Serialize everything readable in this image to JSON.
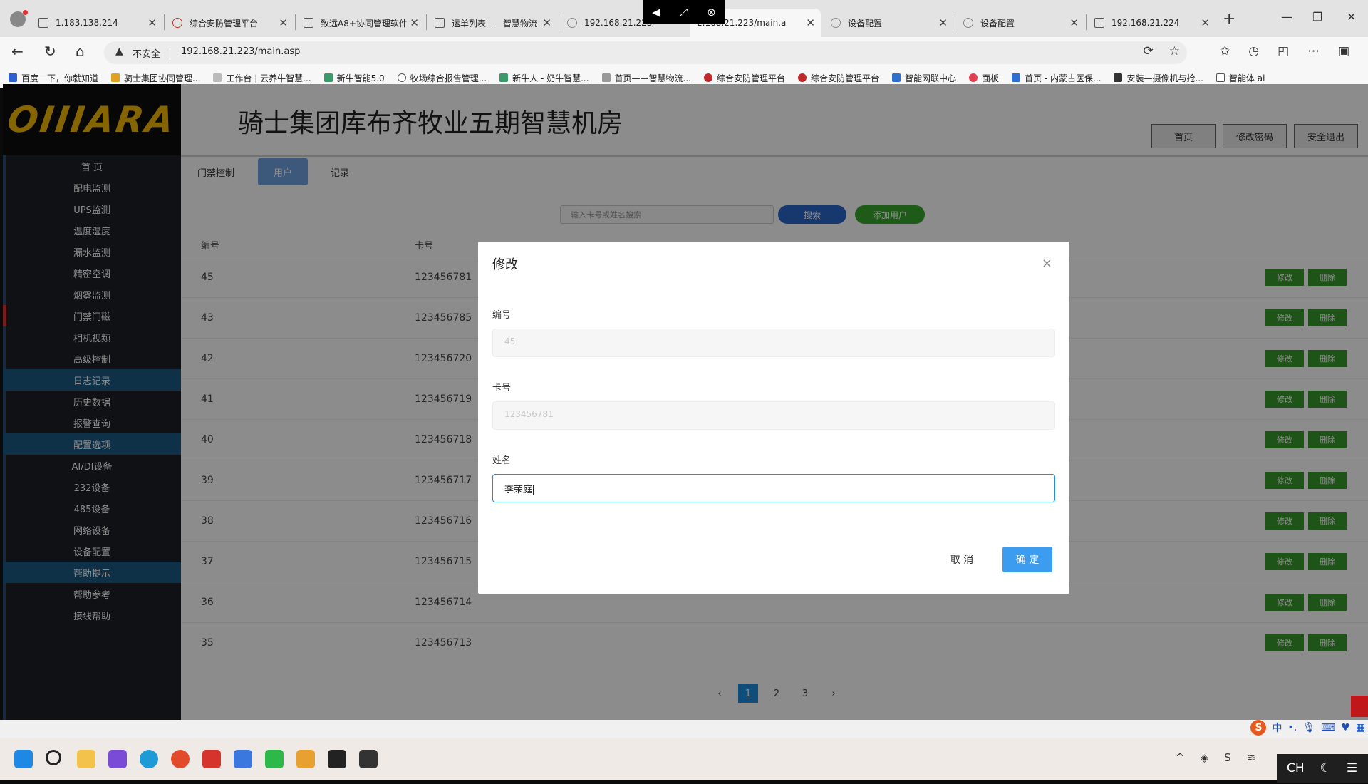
{
  "browser": {
    "tabs": [
      {
        "title": "1.183.138.214"
      },
      {
        "title": "综合安防管理平台"
      },
      {
        "title": "致远A8+协同管理软件"
      },
      {
        "title": "运单列表——智慧物流"
      },
      {
        "title": "192.168.21.223/"
      },
      {
        "title": "2.168.21.223/main.a"
      },
      {
        "title": "设备配置"
      },
      {
        "title": "设备配置"
      },
      {
        "title": "192.168.21.224"
      }
    ],
    "security_label": "不安全",
    "url": "192.168.21.223/main.asp",
    "bookmarks": [
      "百度一下，你就知道",
      "骑士集团协同管理...",
      "工作台 | 云养牛智慧...",
      "新牛智能5.0",
      "牧场综合报告管理...",
      "新牛人 - 奶牛智慧...",
      "首页——智慧物流...",
      "综合安防管理平台",
      "综合安防管理平台",
      "智能网联中心",
      "面板",
      "首页 - 内蒙古医保...",
      "安装—摄像机与抢...",
      "智能体 ai"
    ]
  },
  "header": {
    "logo_text": "OIIIARA",
    "title": "骑士集团库布齐牧业五期智慧机房",
    "buttons": [
      "首页",
      "修改密码",
      "安全退出"
    ]
  },
  "sidebar": {
    "items": [
      {
        "label": "首 页",
        "type": "item"
      },
      {
        "label": "配电监测",
        "type": "item"
      },
      {
        "label": "UPS监测",
        "type": "item"
      },
      {
        "label": "温度湿度",
        "type": "item"
      },
      {
        "label": "漏水监测",
        "type": "item"
      },
      {
        "label": "精密空调",
        "type": "item"
      },
      {
        "label": "烟雾监测",
        "type": "item"
      },
      {
        "label": "门禁门磁",
        "type": "active"
      },
      {
        "label": "相机视频",
        "type": "item"
      },
      {
        "label": "高级控制",
        "type": "item"
      },
      {
        "label": "日志记录",
        "type": "section"
      },
      {
        "label": "历史数据",
        "type": "item"
      },
      {
        "label": "报警查询",
        "type": "item"
      },
      {
        "label": "配置选项",
        "type": "section"
      },
      {
        "label": "AI/DI设备",
        "type": "item"
      },
      {
        "label": "232设备",
        "type": "item"
      },
      {
        "label": "485设备",
        "type": "item"
      },
      {
        "label": "网络设备",
        "type": "item"
      },
      {
        "label": "设备配置",
        "type": "item"
      },
      {
        "label": "帮助提示",
        "type": "section"
      },
      {
        "label": "帮助参考",
        "type": "item"
      },
      {
        "label": "接线帮助",
        "type": "item"
      }
    ]
  },
  "content": {
    "tabs": [
      "门禁控制",
      "用户",
      "记录"
    ],
    "selected_tab": "用户",
    "search_placeholder": "输入卡号或姓名搜索",
    "search_button": "搜索",
    "add_button": "添加用户",
    "columns": [
      "编号",
      "卡号"
    ],
    "rows": [
      {
        "id": "45",
        "card": "123456781"
      },
      {
        "id": "43",
        "card": "123456785"
      },
      {
        "id": "42",
        "card": "123456720"
      },
      {
        "id": "41",
        "card": "123456719"
      },
      {
        "id": "40",
        "card": "123456718"
      },
      {
        "id": "39",
        "card": "123456717"
      },
      {
        "id": "38",
        "card": "123456716"
      },
      {
        "id": "37",
        "card": "123456715"
      },
      {
        "id": "36",
        "card": "123456714"
      },
      {
        "id": "35",
        "card": "123456713"
      }
    ],
    "row_edit_label": "修改",
    "row_delete_label": "删除",
    "pagination": {
      "pages": [
        "1",
        "2",
        "3"
      ],
      "current": "1",
      "prev": "‹",
      "next": "›"
    }
  },
  "modal": {
    "title": "修改",
    "close": "×",
    "fields": [
      {
        "label": "编号",
        "value": "45"
      },
      {
        "label": "卡号",
        "value": "123456781"
      },
      {
        "label": "姓名",
        "value": "李荣庭"
      }
    ],
    "cancel": "取 消",
    "confirm": "确 定"
  },
  "taskbar": {
    "ime_logo": "S",
    "ime_lang": "中",
    "input_lang": "CH"
  },
  "colors": {
    "sidebar_bg": "#1c1f26",
    "sidebar_section": "#1a5a84",
    "primary": "#1f8de0",
    "success": "#3a9a2c",
    "logo": "#f2b705"
  }
}
